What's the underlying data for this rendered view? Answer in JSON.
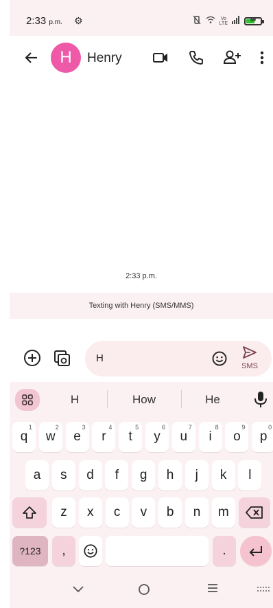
{
  "status_bar": {
    "time": "2:33",
    "ampm": "p.m.",
    "gear_icon": "gear-icon",
    "lte_top": "Vo",
    "lte_bottom": "LTE",
    "network": "4G",
    "battery_level": "59",
    "battery_color": "#2fc12f"
  },
  "app_bar": {
    "avatar_letter": "H",
    "avatar_color": "#ee5aa8",
    "contact_name": "Henry"
  },
  "conversation": {
    "timestamp": "2:33 p.m.",
    "banner": "Texting with Henry (SMS/MMS)"
  },
  "compose": {
    "text": "H",
    "send_label": "SMS"
  },
  "keyboard": {
    "suggestions": [
      "H",
      "How",
      "He"
    ],
    "row1": [
      {
        "k": "q",
        "h": "1"
      },
      {
        "k": "w",
        "h": "2"
      },
      {
        "k": "e",
        "h": "3"
      },
      {
        "k": "r",
        "h": "4"
      },
      {
        "k": "t",
        "h": "5"
      },
      {
        "k": "y",
        "h": "6"
      },
      {
        "k": "u",
        "h": "7"
      },
      {
        "k": "i",
        "h": "8"
      },
      {
        "k": "o",
        "h": "9"
      },
      {
        "k": "p",
        "h": "0"
      }
    ],
    "row2": [
      "a",
      "s",
      "d",
      "f",
      "g",
      "h",
      "j",
      "k",
      "l"
    ],
    "row3": [
      "z",
      "x",
      "c",
      "v",
      "b",
      "n",
      "m"
    ],
    "symbols_label": "?123",
    "comma": ",",
    "period": "."
  }
}
